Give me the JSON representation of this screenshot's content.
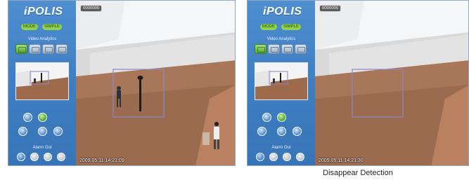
{
  "app": {
    "brand": "iPOLIS"
  },
  "sidebar": {
    "mode_buttons": [
      "MODE",
      "SIMPLE"
    ],
    "video_analytics_label": "Video Analytics",
    "va_buttons": [
      "passing-icon",
      "entering-icon",
      "exiting-icon",
      "appearing-icon"
    ],
    "alarm_out_label": "Alarm Out"
  },
  "panels": [
    {
      "rec_badge": "0000000",
      "timestamp": "2009.05.11 14:21:09"
    },
    {
      "rec_badge": "0000000",
      "timestamp": "2009.05.11 14:21:30"
    }
  ],
  "caption": "Disappear Detection"
}
